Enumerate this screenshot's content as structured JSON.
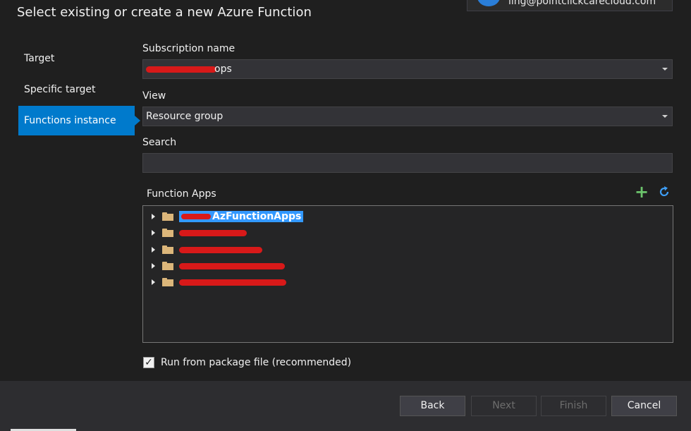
{
  "dialog": {
    "title": "Select existing or create a new Azure Function",
    "account_email": "ling@pointclickcarecloud.com"
  },
  "nav": {
    "items": [
      {
        "label": "Target",
        "active": false
      },
      {
        "label": "Specific target",
        "active": false
      },
      {
        "label": "Functions instance",
        "active": true
      }
    ]
  },
  "form": {
    "subscription_label": "Subscription name",
    "subscription_value_suffix": "ops",
    "view_label": "View",
    "view_value": "Resource group",
    "search_label": "Search",
    "search_value": "",
    "function_apps_label": "Function Apps"
  },
  "tree": {
    "items": [
      {
        "name": "AzFunctionApps",
        "selected": true
      },
      {
        "name": "",
        "selected": false
      },
      {
        "name": "",
        "selected": false
      },
      {
        "name": "",
        "selected": false
      },
      {
        "name": "",
        "selected": false
      }
    ]
  },
  "options": {
    "run_from_package_label": "Run from package file (recommended)",
    "run_from_package_checked": true
  },
  "buttons": {
    "back": "Back",
    "next": "Next",
    "finish": "Finish",
    "cancel": "Cancel"
  },
  "icons": {
    "add": "plus-icon",
    "refresh": "refresh-icon",
    "folder": "folder-icon",
    "expander": "chevron-right-icon"
  },
  "colors": {
    "accent": "#007acc",
    "background": "#1f1f1f",
    "selection": "#3399ff",
    "add_icon": "#6bc46b",
    "refresh_icon": "#3e9ef6",
    "folder": "#dcb67a"
  }
}
